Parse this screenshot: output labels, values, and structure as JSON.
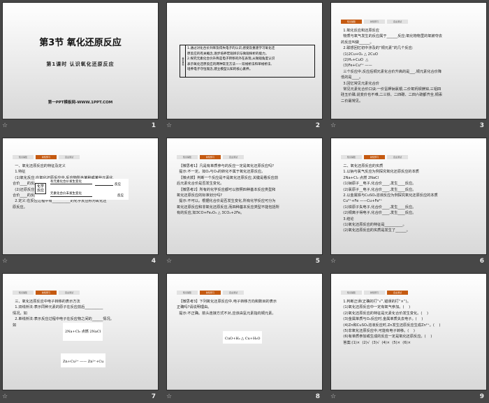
{
  "tabs": [
    "知识铺垫",
    "新知预习",
    "自主测试"
  ],
  "slides": [
    {
      "num": "1",
      "title": "第3节  氧化还原反应",
      "subtitle": "第1课时   认识氧化还原反应",
      "footer": "第一PPT模板网-WWW.1PPT.COM"
    },
    {
      "num": "2",
      "side": "素养目标",
      "lines": [
        "1.通过对化合价升降及得失电子的认识,感受及重建学习氧化还",
        "原反应的有关概念,逐步培养宏观辨识与微观探析的能力。",
        "2.探究元素化合价升降是电子转移的外在表现,从微观角度认识",
        "表示氧化还原反应的两种常见方法——双线桥法和单线桥法,",
        "培养电子守恒观念,建立模型认知的核心素养。"
      ]
    },
    {
      "num": "3",
      "active_tab": 0,
      "lines": [
        "  1.氧化反应和还原反应",
        "  物质与氧气发生的反应属于______反应;氧化物物里的氧被夺去",
        "的反应叫做______。",
        "  2.联想回忆初中涉及的“铜元素”的几个反应:",
        "  (1)2Cu+O₂ △ 2CuO",
        "  (2)H₂+CuO  △",
        "  (3)Fe+Cu²⁺ ——",
        "  三个反应中,反应后铜元素化合价升高的是___,铜元素化合价降",
        "低的是____。",
        "  3.回忆常见元素化合价",
        "  常见元素化合价口诀:一价氢钾钠氯银,二价氧钙钡镁锌,三铝四",
        "硅五价磷,说变价也不难,二三铁、二四碳、二四六硫都齐全,铜汞",
        "二价最常见。"
      ]
    },
    {
      "num": "4",
      "active_tab": 1,
      "lines": [
        "  一、氧化还原反应的特征及定义",
        "  1.特征",
        "",
        "",
        "",
        "  (1)氧化反应:在氧化还原反应中,反应物所含某种或某些元素化",
        "合价____的反应。",
        "  (2)还原反应:在氧化还原反应中,反应物所含某种或某些元素化",
        "合价____的反应。",
        "  2.定义:在反应过程中有__________的化学反应称为氧化还",
        "原反应。"
      ],
      "diagram": {
        "box": "化学\n反应",
        "top": "有元素化合价发生变化",
        "bottom": "元素化合价未发生变化",
        "suffix": "反应"
      }
    },
    {
      "num": "5",
      "active_tab": 1,
      "lines": [
        "",
        "  【微思考1】凡是有单质参与的反应一定是氧化还原反应吗?",
        "  提示:不一定。如O₂与O₃的转化不属于氧化还原反应。",
        "  【微点拨】判断一个反应是不是氧化还原反应,关键是看反应前",
        "后元素化合价是否发生变化。",
        "  【微思考2】所有的化学反应都可以按照四种基本反应类型和",
        "氧化还原反应的标准划分吗?",
        "  提示:不可以。根据化合价是否发生变化,所有化学反应可分为",
        "氧化还原反应和非氧化还原反应,而四种基本反应类型不能包括所",
        "有的反应,如3CO+Fe₂O₃ △ 3CO₂+2Fe。"
      ]
    },
    {
      "num": "6",
      "active_tab": 1,
      "lines": [
        "  二、氧化还原反应的实质",
        "  1.以钠与氯气反应为例探究氧化还原反应的本质",
        "  2Na+Cl₂ 点燃 2NaCl",
        "  (1)钠原子__电子,化合价____,发生____反应。",
        "  (2)氯原子__电子,化合价____,发生____反应。",
        "  2.以金属铁与CuSO₄溶液反应为例探究氧化还原反应的本质",
        "  Cu²⁺+Fe ——Cu+Fe²⁺",
        "  (1)铁原子失电子,化合价____,发生____反应。",
        "  (2)铜离子得电子,化合价____,发生____反应。",
        "  3.结论",
        "  (1)氧化还原反应的特征是__________。",
        "  (2)氧化还原反应的实质是发生了______。"
      ]
    },
    {
      "num": "7",
      "active_tab": 1,
      "lines": [
        "",
        "  三、氧化还原反应中电子转移的表示方法",
        "  1.双线桥法:表示同种元素的原子在反应前后__________",
        "情况。如",
        "",
        "",
        "",
        "  2.单线桥法:表示反应过程中电子在反应物之间的______情况。",
        "如"
      ],
      "eq1": "2Na+Cl₂ 点燃 2NaCl",
      "eq2": "Zn+Cu²⁺ —— Zn²⁺+Cu"
    },
    {
      "num": "8",
      "active_tab": 1,
      "lines": [
        "",
        "",
        "",
        "  【微思考3】下列氧化还原反应中,电子转移方向和数目的表示",
        "正确吗?请说明理由。",
        "",
        "",
        "  提示:不正确。箭头连接方式不对,应该由氢元素指向铜元素。"
      ],
      "eq": "CuO+H₂ △ Cu+H₂O"
    },
    {
      "num": "9",
      "active_tab": 2,
      "lines": [
        "",
        "",
        "  1.判断正误(正确的打“√”,错误的打“×”)。",
        "  (1)氧化还原反应中一定有氧气参加。(    )",
        "  (2)氧化还原反应的特征是元素化合价发生变化。(    )",
        "  (3)金属单质与O₂反应时,金属单质失去电子。(    )",
        "  (4)Zn和CuSO₄溶液反应时,Zn发生还原反应生成Zn²⁺。(    )",
        "  (5)非氧化还原反应中,可能有电子转移。(    )",
        "  (6)有单质参加或生成的反应一定是氧化还原反应。(    )",
        "  答案:(1)×  (2)√  (3)√  (4)×  (5)×  (6)×"
      ]
    }
  ],
  "colors": {
    "accent": "#c55a11",
    "background": "#474747",
    "hint": "#e00000"
  }
}
